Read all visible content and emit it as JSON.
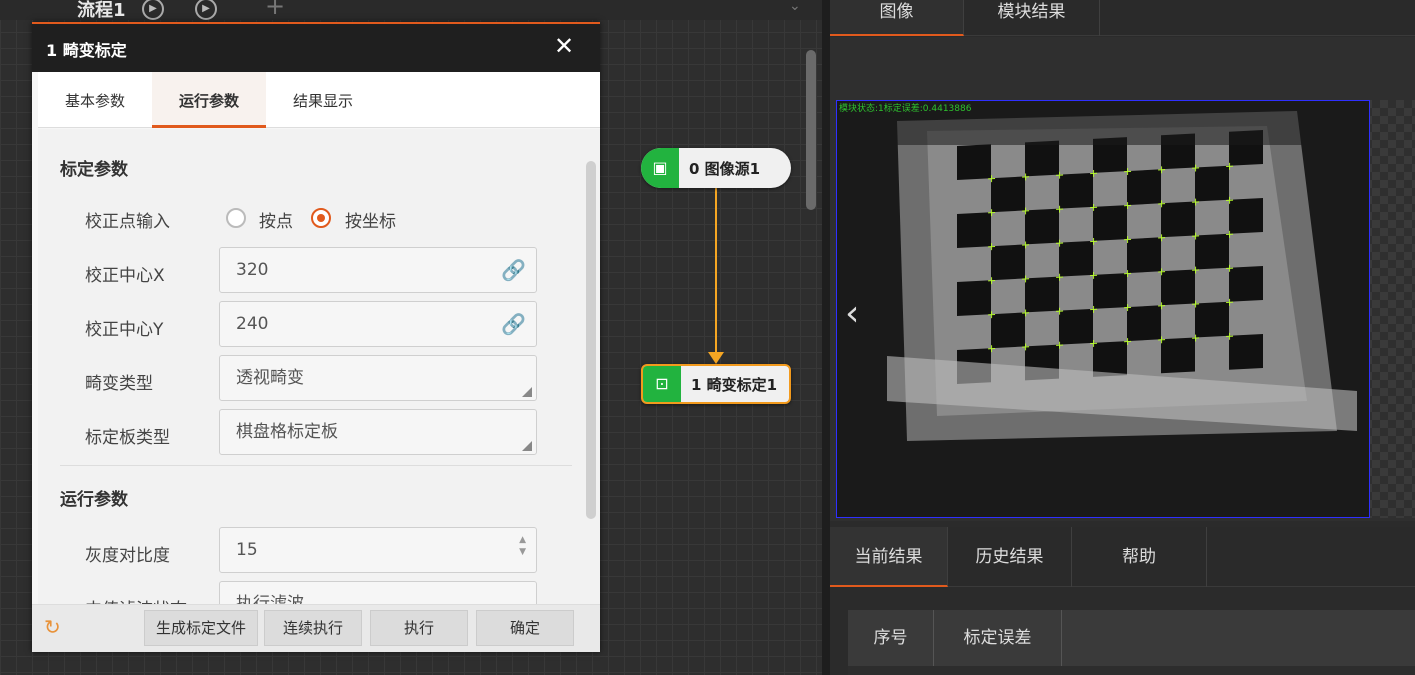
{
  "flow": {
    "title": "流程1"
  },
  "dialog": {
    "title": "1 畸变标定",
    "tabs": [
      "基本参数",
      "运行参数",
      "结果显示"
    ],
    "sections": {
      "calib": "标定参数",
      "run": "运行参数"
    },
    "fields": {
      "corr_input": {
        "label": "校正点输入",
        "options": [
          "按点",
          "按坐标"
        ],
        "selected": "按坐标"
      },
      "center_x": {
        "label": "校正中心X",
        "value": "320"
      },
      "center_y": {
        "label": "校正中心Y",
        "value": "240"
      },
      "distort_type": {
        "label": "畸变类型",
        "value": "透视畸变"
      },
      "board_type": {
        "label": "标定板类型",
        "value": "棋盘格标定板"
      },
      "gray_contrast": {
        "label": "灰度对比度",
        "value": "15"
      },
      "median_filter": {
        "label": "中值滤波状态",
        "value": "执行滤波"
      }
    },
    "buttons": {
      "gen_file": "生成标定文件",
      "continuous": "连续执行",
      "execute": "执行",
      "confirm": "确定"
    }
  },
  "nodes": [
    {
      "label": "0 图像源1"
    },
    {
      "label": "1 畸变标定1"
    }
  ],
  "right": {
    "tabs": [
      "图像",
      "模块结果"
    ],
    "image_status": "模块状态:1标定误差:0.4413886",
    "bottom_tabs": [
      "当前结果",
      "历史结果",
      "帮助"
    ],
    "table_headers": [
      "序号",
      "标定误差"
    ]
  },
  "colors": {
    "accent": "#e15a1d",
    "node_green": "#22b33f",
    "connector": "#f5a623"
  }
}
